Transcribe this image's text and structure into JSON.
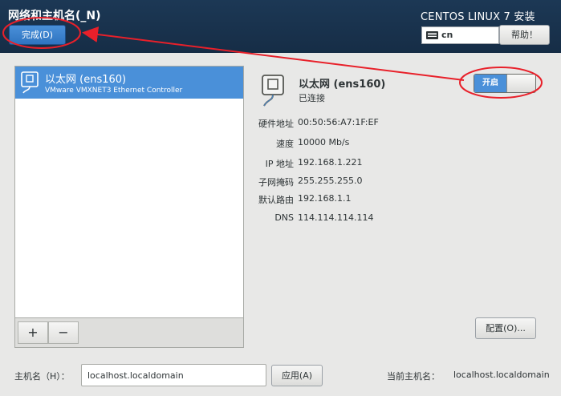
{
  "header": {
    "page_title": "网络和主机名(_N)",
    "done_label": "完成(D)",
    "product_title": "CENTOS LINUX 7 安装",
    "keyboard_layout": "cn",
    "help_label": "帮助！"
  },
  "device_list": {
    "items": [
      {
        "name": "以太网 (ens160)",
        "description": "VMware VMXNET3 Ethernet Controller",
        "selected": true
      }
    ],
    "add_label": "+",
    "remove_label": "−"
  },
  "device_detail": {
    "name": "以太网 (ens160)",
    "status": "已连接",
    "toggle_label": "开启",
    "toggle_state": "on",
    "fields": [
      {
        "label": "硬件地址",
        "value": "00:50:56:A7:1F:EF"
      },
      {
        "label": "速度",
        "value": "10000 Mb/s"
      },
      {
        "label": "IP 地址",
        "value": "192.168.1.221"
      },
      {
        "label": "子网掩码",
        "value": "255.255.255.0"
      },
      {
        "label": "默认路由",
        "value": "192.168.1.1"
      },
      {
        "label": "DNS",
        "value": "114.114.114.114"
      }
    ],
    "configure_label": "配置(O)..."
  },
  "hostname": {
    "label": "主机名（H）：",
    "value": "localhost.localdomain",
    "apply_label": "应用(A)",
    "current_label": "当前主机名：",
    "current_value": "localhost.localdomain"
  },
  "colors": {
    "header_bg": "#1c3855",
    "accent": "#4a90d9",
    "annotation": "#e8202a",
    "window_bg": "#e8e8e7"
  },
  "icons": [
    "keyboard-icon",
    "network-card-icon"
  ]
}
